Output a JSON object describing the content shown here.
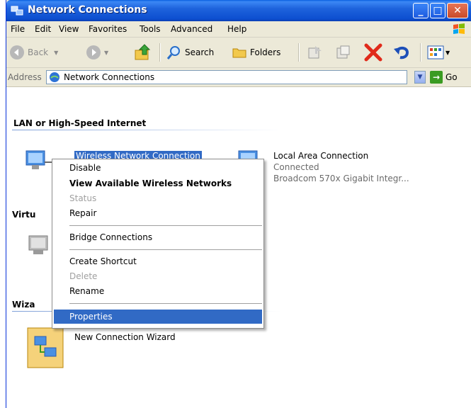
{
  "window": {
    "title": "Network Connections"
  },
  "titlebar_buttons": {
    "minimize": "_",
    "maximize": "□",
    "close": "✕"
  },
  "menu": [
    "File",
    "Edit",
    "View",
    "Favorites",
    "Tools",
    "Advanced",
    "Help"
  ],
  "toolbar": {
    "back": "Back",
    "search": "Search",
    "folders": "Folders"
  },
  "address": {
    "label": "Address",
    "value": "Network Connections",
    "go": "Go"
  },
  "groups": {
    "lan": "LAN or High-Speed Internet",
    "virtual_cut": "Virtu",
    "wizard_cut": "Wiza"
  },
  "connections": {
    "wireless": {
      "name": "Wireless Network Connection"
    },
    "local": {
      "name": "Local Area Connection",
      "status": "Connected",
      "device": "Broadcom 570x Gigabit Integr..."
    },
    "wizard": {
      "name": "New Connection Wizard"
    }
  },
  "context_menu": {
    "disable": "Disable",
    "view_wireless": "View Available Wireless Networks",
    "status": "Status",
    "repair": "Repair",
    "bridge": "Bridge Connections",
    "create_shortcut": "Create Shortcut",
    "delete": "Delete",
    "rename": "Rename",
    "properties": "Properties"
  },
  "colors": {
    "accent": "#316ac5",
    "titlebar": "#0a5fe0",
    "disabled": "#a0a0a0"
  }
}
